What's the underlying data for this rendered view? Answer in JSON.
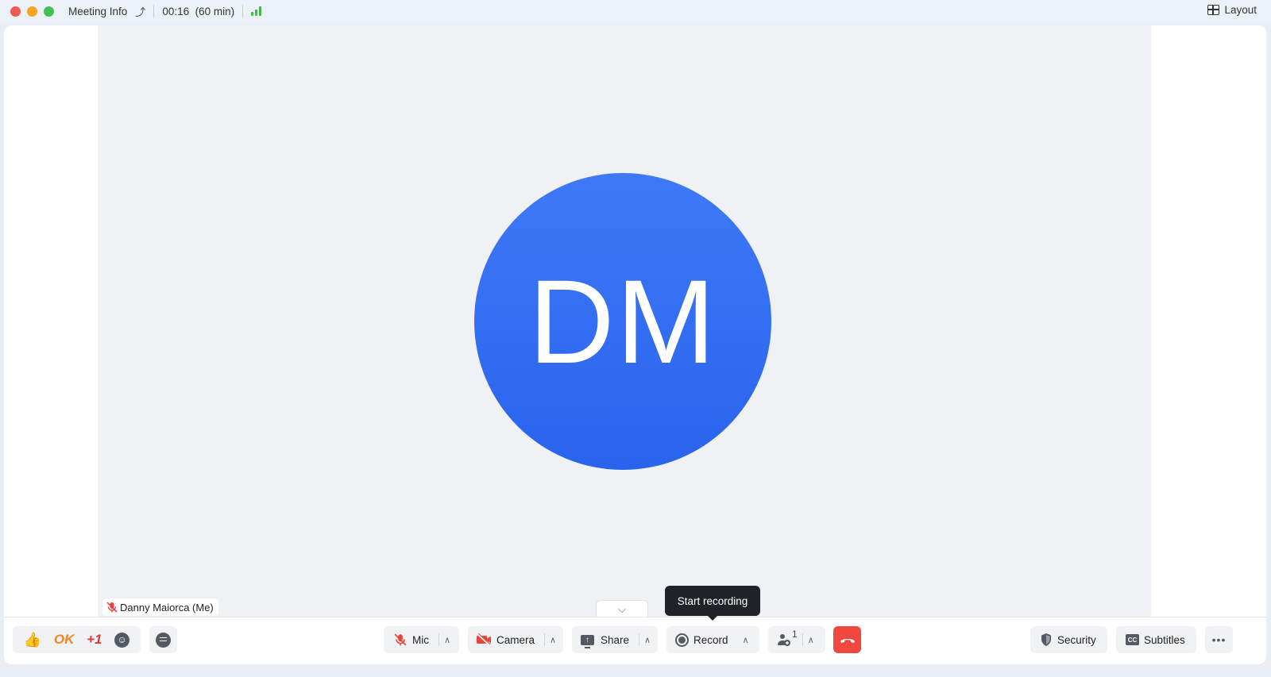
{
  "titlebar": {
    "meeting_info_label": "Meeting Info",
    "elapsed": "00:16",
    "duration": "(60 min)",
    "layout_label": "Layout",
    "signal_color": "#3dbb4c"
  },
  "stage": {
    "avatar_initials": "DM",
    "avatar_color": "#3a72f5",
    "participant_name": "Danny Maiorca (Me)",
    "participant_mic_state": "muted"
  },
  "tooltip": {
    "text": "Start recording"
  },
  "toolbar": {
    "reactions": {
      "thumbs_up": "👍",
      "ok": "OK",
      "plus_one": "+1",
      "emoji": "☺"
    },
    "mic_label": "Mic",
    "camera_label": "Camera",
    "share_label": "Share",
    "record_label": "Record",
    "participant_count": "1",
    "security_label": "Security",
    "subtitles_label": "Subtitles",
    "cc_text": "CC",
    "more_label": "•••",
    "hangup_color": "#f0483f"
  }
}
